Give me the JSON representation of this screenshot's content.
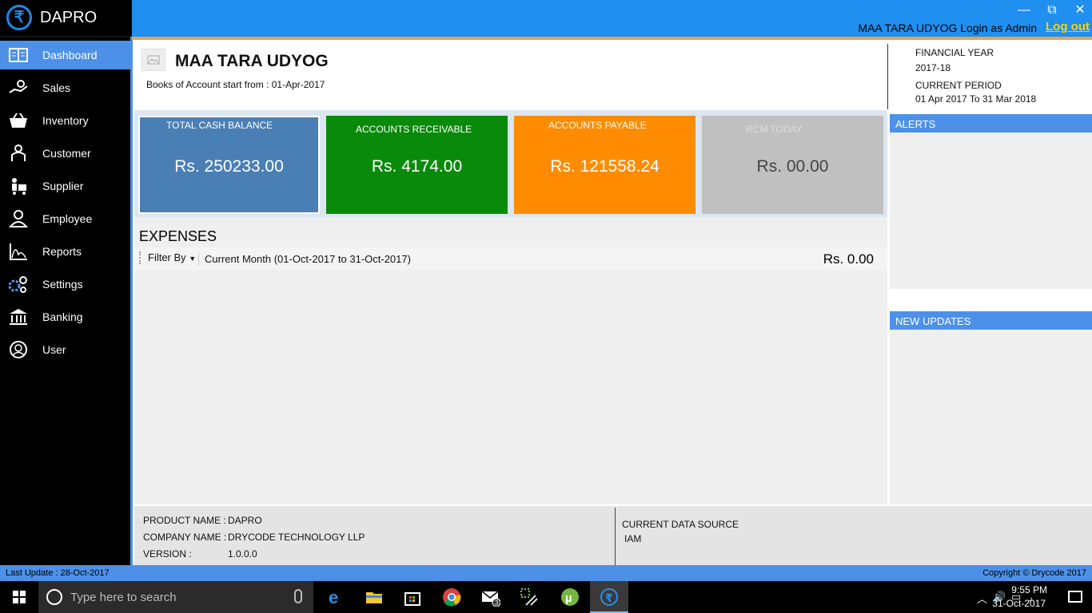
{
  "app": {
    "name": "DAPRO",
    "logo_glyph": "₹"
  },
  "titlebar": {
    "login_text": "MAA TARA UDYOG Login as Admin",
    "logout_label": "Log out",
    "minimize_glyph": "—",
    "maximize_glyph": "⧉",
    "close_glyph": "✕"
  },
  "sidebar": {
    "items": [
      {
        "label": "Dashboard",
        "icon": "dashboard-icon",
        "active": true
      },
      {
        "label": "Sales",
        "icon": "sales-hand-icon"
      },
      {
        "label": "Inventory",
        "icon": "basket-icon"
      },
      {
        "label": "Customer",
        "icon": "customer-icon"
      },
      {
        "label": "Supplier",
        "icon": "supplier-icon"
      },
      {
        "label": "Employee",
        "icon": "employee-icon"
      },
      {
        "label": "Reports",
        "icon": "reports-icon"
      },
      {
        "label": "Settings",
        "icon": "settings-icon"
      },
      {
        "label": "Banking",
        "icon": "bank-icon"
      },
      {
        "label": "User",
        "icon": "user-icon"
      }
    ]
  },
  "company": {
    "name": "MAA TARA UDYOG",
    "books_start": "Books of Account start from : 01-Apr-2017"
  },
  "financial": {
    "fy_label": "FINANCIAL YEAR",
    "fy_value": "2017-18",
    "period_label": "CURRENT PERIOD",
    "period_value": "01 Apr 2017  To  31 Mar 2018"
  },
  "cards": [
    {
      "title": "TOTAL CASH BALANCE",
      "value": "Rs. 250233.00",
      "color": "#4a7fb5"
    },
    {
      "title": "ACCOUNTS RECEIVABLE",
      "value": "Rs. 4174.00",
      "color": "#0a8a0a"
    },
    {
      "title": "ACCOUNTS PAYABLE",
      "value": "Rs. 121558.24",
      "color": "#ff8c00"
    },
    {
      "title": "RCM TODAY",
      "value": "Rs. 00.00",
      "color": "#c0c0c0"
    }
  ],
  "expenses": {
    "title": "EXPENSES",
    "filter_label": "Filter By",
    "period": "Current Month (01-Oct-2017 to 31-Oct-2017)",
    "total": "Rs. 0.00"
  },
  "alerts": {
    "title": "ALERTS"
  },
  "updates": {
    "title": "NEW UPDATES"
  },
  "info": {
    "product_label": "PRODUCT NAME :",
    "product_value": "DAPRO",
    "company_label": "COMPANY NAME :",
    "company_value": "DRYCODE TECHNOLOGY LLP",
    "version_label": "VERSION :",
    "version_value": "1.0.0.0",
    "datasource_label": "CURRENT DATA SOURCE",
    "datasource_value": "IAM"
  },
  "statusbar": {
    "last_update": "Last Update : 28-Oct-2017",
    "copyright": "Copyright © Drycode 2017"
  },
  "taskbar": {
    "search_placeholder": "Type here to search",
    "mail_badge": "3",
    "time": "9:55 PM",
    "date": "31-Oct-2017"
  },
  "colors": {
    "accent": "#4d90e8",
    "titlebar": "#1f8ff0",
    "logout": "#ffd200"
  }
}
